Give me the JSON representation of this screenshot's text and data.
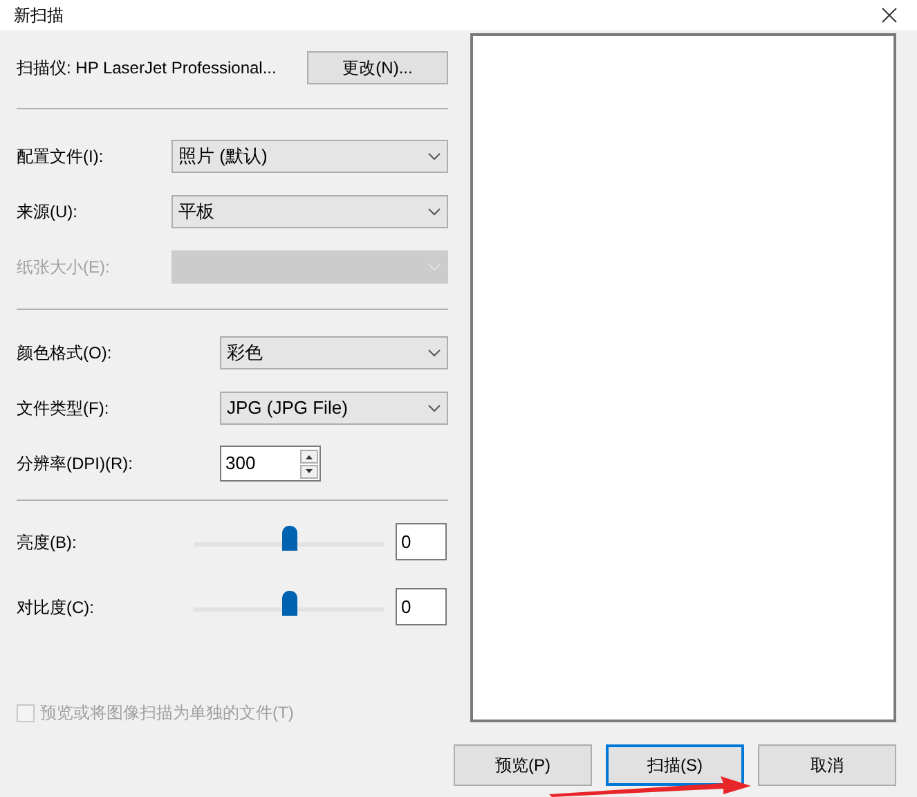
{
  "window": {
    "title": "新扫描"
  },
  "scanner": {
    "label": "扫描仪: HP LaserJet Professional...",
    "change_button": "更改(N)..."
  },
  "source_group": [
    {
      "label": "配置文件(I):",
      "value": "照片 (默认)",
      "disabled": false
    },
    {
      "label": "来源(U):",
      "value": "平板",
      "disabled": false
    },
    {
      "label": "纸张大小(E):",
      "disabled": true
    }
  ],
  "format_group": [
    {
      "kind": "dropdown",
      "label": "颜色格式(O):",
      "value": "彩色"
    },
    {
      "kind": "dropdown",
      "label": "文件类型(F):",
      "value": "JPG (JPG File)"
    },
    {
      "kind": "spinner",
      "label": "分辨率(DPI)(R):",
      "value": "300"
    }
  ],
  "adjustments": [
    {
      "label": "亮度(B):",
      "level": 0.5,
      "value": "0"
    },
    {
      "label": "对比度(C):",
      "level": 0.5,
      "value": "0"
    }
  ],
  "separate_files": {
    "label": "预览或将图像扫描为单独的文件(T)",
    "checked": false,
    "disabled": true
  },
  "buttons": [
    {
      "label": "预览(P)",
      "default": false
    },
    {
      "label": "扫描(S)",
      "default": true
    },
    {
      "label": "取消",
      "default": false
    }
  ]
}
